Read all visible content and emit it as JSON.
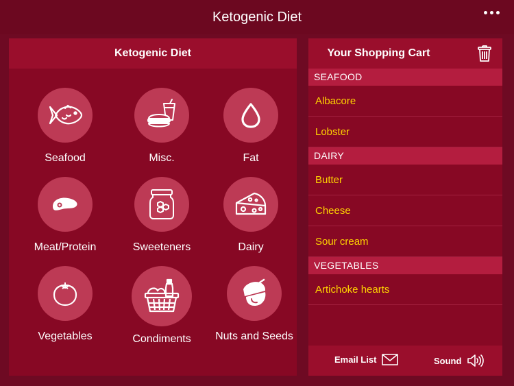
{
  "app": {
    "title": "Ketogenic Diet"
  },
  "left_panel": {
    "title": "Ketogenic Diet",
    "categories": [
      {
        "label": "Seafood",
        "icon": "fish-icon"
      },
      {
        "label": "Misc.",
        "icon": "burger-drink-icon"
      },
      {
        "label": "Fat",
        "icon": "drop-icon"
      },
      {
        "label": "Meat/Protein",
        "icon": "steak-icon"
      },
      {
        "label": "Sweeteners",
        "icon": "honey-jar-icon"
      },
      {
        "label": "Dairy",
        "icon": "cheese-icon"
      },
      {
        "label": "Vegetables",
        "icon": "tomato-icon"
      },
      {
        "label": "Condiments",
        "icon": "basket-icon"
      },
      {
        "label": "Nuts and Seeds",
        "icon": "acorn-icon"
      }
    ]
  },
  "cart": {
    "title": "Your Shopping Cart",
    "sections": [
      {
        "name": "SEAFOOD",
        "items": [
          "Albacore",
          "Lobster"
        ]
      },
      {
        "name": "DAIRY",
        "items": [
          "Butter",
          "Cheese",
          "Sour cream"
        ]
      },
      {
        "name": "VEGETABLES",
        "items": [
          "Artichoke hearts"
        ]
      }
    ],
    "footer": {
      "email_label": "Email List",
      "sound_label": "Sound"
    }
  },
  "colors": {
    "background": "#6e0a23",
    "panel": "#870824",
    "panel_header": "#9a0e2c",
    "section_header": "#b41d3f",
    "icon_circle": "#bd3a55",
    "item_text": "#ffd400"
  }
}
